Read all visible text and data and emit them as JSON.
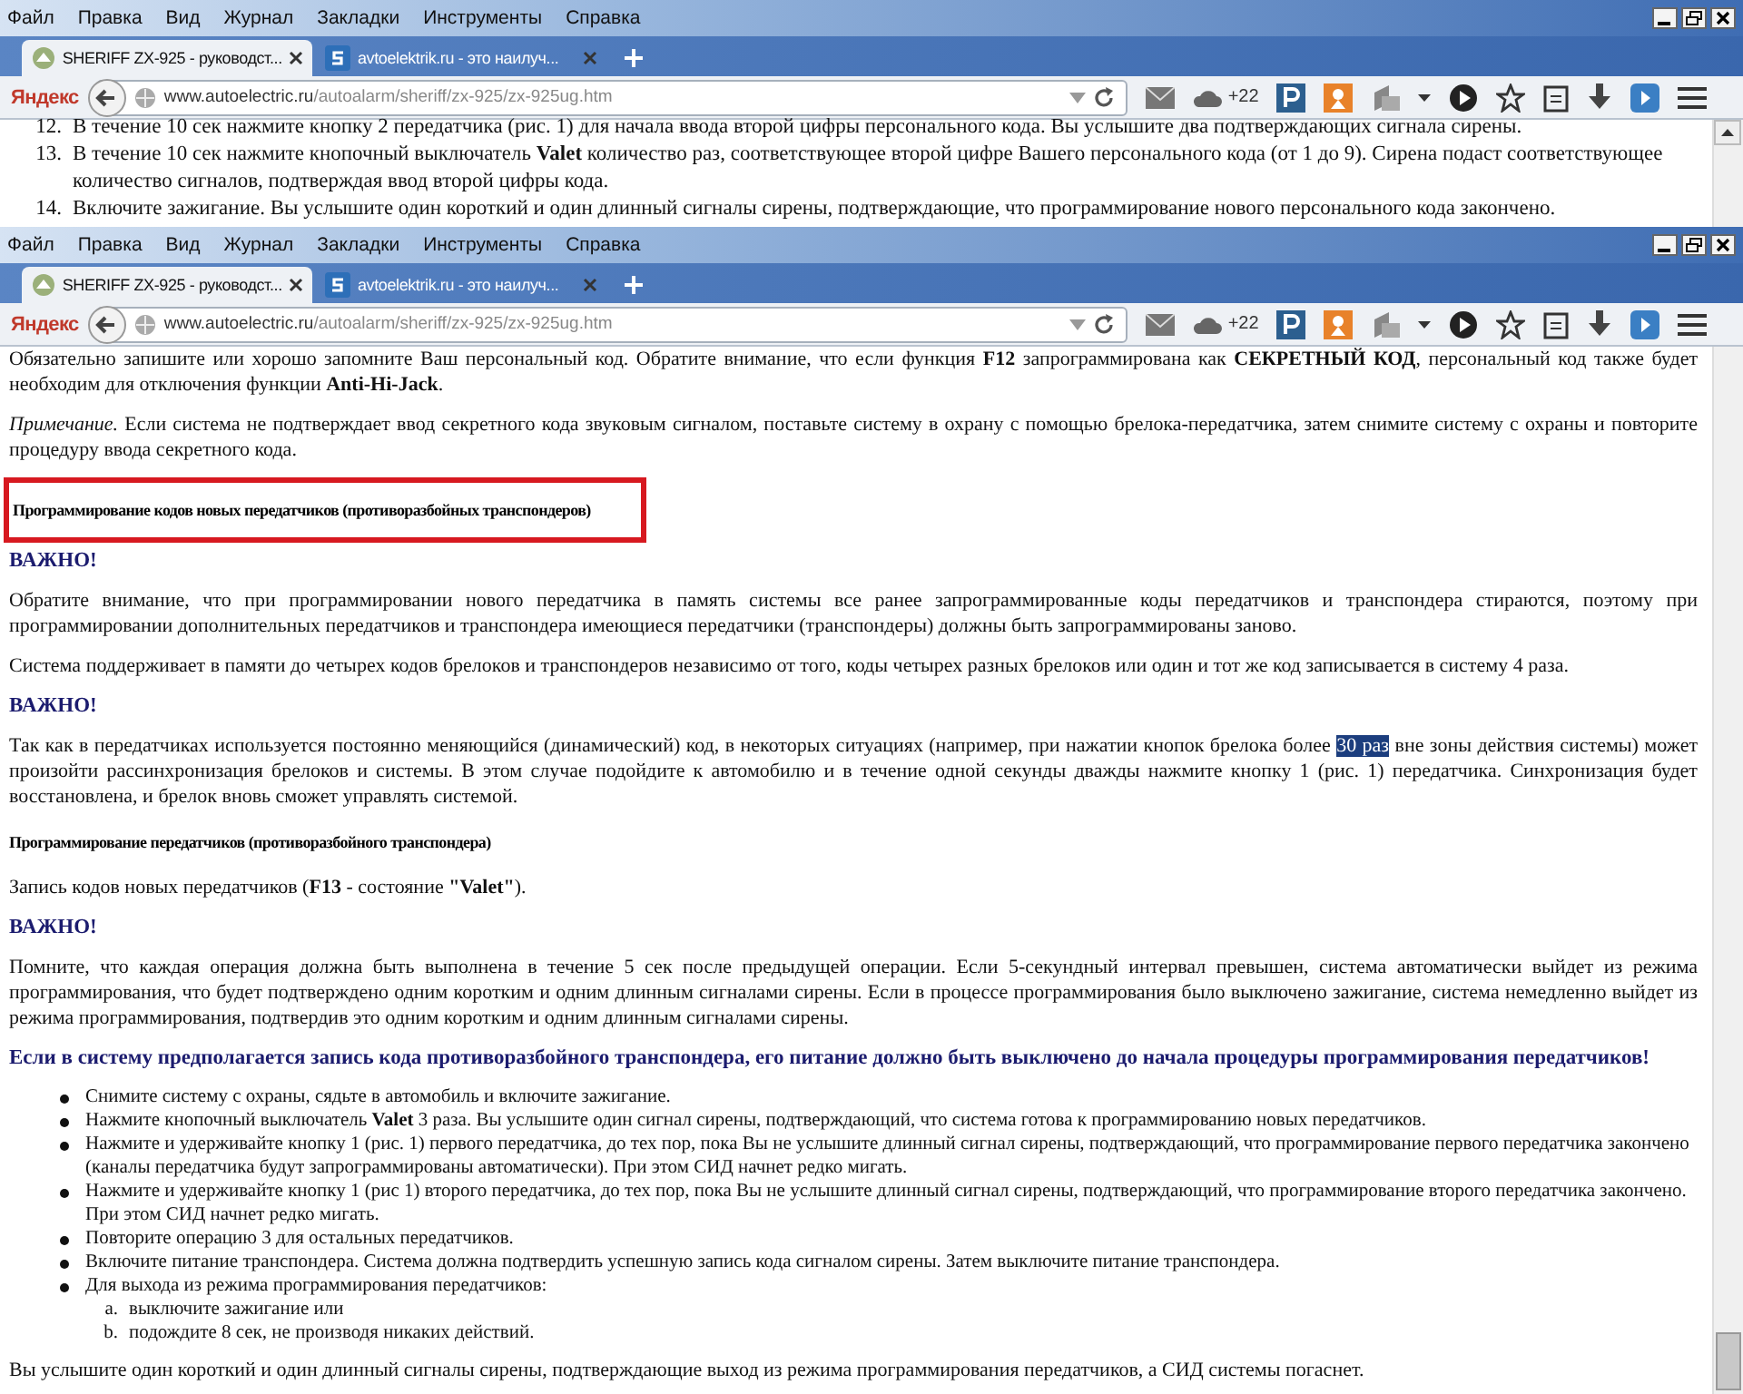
{
  "windows": [
    {
      "menu": [
        "Файл",
        "Правка",
        "Вид",
        "Журнал",
        "Закладки",
        "Инструменты",
        "Справка"
      ],
      "tabs": [
        {
          "title": "SHERIFF ZX-925 - руководст...",
          "selected": true
        },
        {
          "title": "avtoelektrik.ru - это наилуч...",
          "selected": false
        }
      ],
      "toolbar": {
        "brand": "Яндекс",
        "url_host": "www.autoelectric.ru",
        "url_path": "/autoalarm/sheriff/zx-925/zx-925ug.htm",
        "weather": "+22"
      },
      "content": [
        {
          "kind": "numbered",
          "items": [
            {
              "number": "12.",
              "text": "В течение 10 сек нажмите кнопку 2 передатчика (рис. 1) для начала ввода второй цифры персонального кода. Вы услышите два подтверждающих сигнала сирены."
            },
            {
              "number": "13.",
              "text": "В течение 10 сек нажмите кнопочный выключатель **Valet** количество раз, соответствующее второй цифре Вашего персонального кода (от 1 до 9). Сирена подаст соответствующее количество сигналов, подтверждая ввод второй цифры кода."
            },
            {
              "number": "14.",
              "text": "Включите зажигание. Вы услышите один короткий и один длинный сигналы сирены, подтверждающие, что программирование нового персонального кода закончено."
            }
          ]
        }
      ]
    },
    {
      "menu": [
        "Файл",
        "Правка",
        "Вид",
        "Журнал",
        "Закладки",
        "Инструменты",
        "Справка"
      ],
      "tabs": [
        {
          "title": "SHERIFF ZX-925 - руководст...",
          "selected": true
        },
        {
          "title": "avtoelektrik.ru - это наилуч...",
          "selected": false
        }
      ],
      "toolbar": {
        "brand": "Яндекс",
        "url_host": "www.autoelectric.ru",
        "url_path": "/autoalarm/sheriff/zx-925/zx-925ug.htm",
        "weather": "+22"
      },
      "content": [
        {
          "kind": "paragraph",
          "text": "Обязательно запишите или хорошо запомните Ваш персональный код. Обратите внимание, что если функция **F12** запрограммирована как **СЕКРЕТНЫЙ КОД**, персональный код также будет необходим для отключения функции **Anti-Hi-Jack**."
        },
        {
          "kind": "note",
          "text": "*Примечание.* Если система не подтверждает ввод секретного кода звуковым сигналом, поставьте систему в охрану с помощью брелока-передатчика, затем снимите систему с охраны и повторите процедуру ввода секретного кода."
        },
        {
          "kind": "heading",
          "text": "Программирование кодов новых передатчиков (противоразбойных транспондеров)",
          "highlighted": true
        },
        {
          "kind": "important",
          "text": "ВАЖНО!"
        },
        {
          "kind": "paragraph",
          "text": "Обратите внимание, что при программировании нового передатчика в память системы все ранее запрограммированные коды передатчиков и транспондера стираются, поэтому при программировании дополнительных передатчиков и транспондера имеющиеся передатчики (транспондеры) должны быть запрограммированы заново."
        },
        {
          "kind": "paragraph",
          "text": "Система поддерживает в памяти до четырех кодов брелоков и транспондеров независимо от того, коды четырех разных брелоков или один и тот же код записывается в систему 4 раза."
        },
        {
          "kind": "important",
          "text": "ВАЖНО!"
        },
        {
          "kind": "parts",
          "parts": [
            {
              "text": "Так как в передатчиках используется постоянно меняющийся (динамический) код, в некоторых ситуациях (например, при нажатии кнопок брелока более ",
              "selected": false
            },
            {
              "text": "30 раз",
              "selected": true
            },
            {
              "text": " вне зоны действия системы) может произойти рассинхронизация брелоков и системы. В этом случае подойдите к автомобилю и в течение одной секунды дважды нажмите кнопку 1 (рис. 1) передатчика. Синхронизация будет восстановлена, и брелок вновь сможет управлять системой.",
              "selected": false
            }
          ]
        },
        {
          "kind": "heading",
          "text": "Программирование передатчиков (противоразбойного транспондера)",
          "highlighted": false
        },
        {
          "kind": "paragraph",
          "text": "Запись кодов новых передатчиков (**F13** - состояние **\"Valet\"**)."
        },
        {
          "kind": "important",
          "text": "ВАЖНО!"
        },
        {
          "kind": "paragraph",
          "text": "Помните, что каждая операция должна быть выполнена в течение 5 сек после предыдущей операции. Если 5-секундный интервал превышен, система автоматически выйдет из режима программирования, что будет подтверждено одним коротким и одним длинным сигналами сирены. Если в процессе программирования было выключено зажигание, система немедленно выйдет из режима программирования, подтвердив это одним коротким и одним длинным сигналами сирены."
        },
        {
          "kind": "important",
          "text": "Если в систему предполагается запись кода противоразбойного транспондера, его питание должно быть выключено до начала процедуры программирования передатчиков!"
        },
        {
          "kind": "bullets",
          "items": [
            {
              "text": "Снимите систему с охраны, сядьте в автомобиль и включите зажигание."
            },
            {
              "text": "Нажмите кнопочный выключатель **Valet** 3 раза. Вы услышите один сигнал сирены, подтверждающий, что система готова к программированию новых передатчиков."
            },
            {
              "text": "Нажмите и удерживайте кнопку 1 (рис. 1) первого передатчика, до тех пор, пока Вы не услышите длинный сигнал сирены, подтверждающий, что программирование первого передатчика закончено (каналы передатчика будут запрограммированы автоматически). При этом СИД начнет редко мигать."
            },
            {
              "text": "Нажмите и удерживайте кнопку 1 (рис 1) второго передатчика, до тех пор, пока Вы не услышите длинный сигнал сирены, подтверждающий, что программирование второго передатчика закончено. При этом СИД начнет редко мигать."
            },
            {
              "text": "Повторите операцию 3 для остальных передатчиков."
            },
            {
              "text": "Включите питание транспондера. Система должна подтвердить успешную запись кода сигналом сирены. Затем выключите питание транспондера."
            },
            {
              "text": "Для выхода из режима программирования передатчиков:",
              "children": [
                {
                  "marker": "a.",
                  "text": "выключите зажигание или"
                },
                {
                  "marker": "b.",
                  "text": "подождите 8 сек, не производя никаких действий."
                }
              ]
            }
          ]
        },
        {
          "kind": "paragraph",
          "text": "Вы услышите один короткий и один длинный сигналы сирены, подтверждающие выход из режима программирования передатчиков, а СИД системы погаснет."
        }
      ]
    }
  ]
}
